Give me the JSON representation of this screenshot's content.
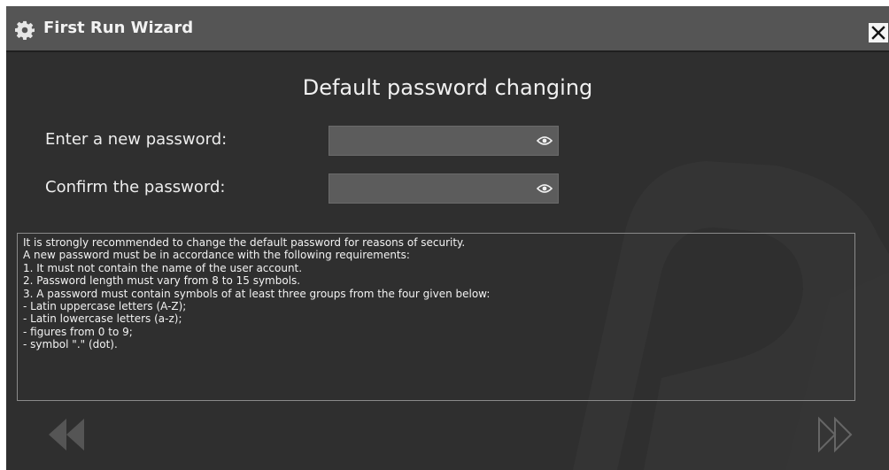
{
  "window": {
    "title": "First Run Wizard",
    "title_icon": "gear-icon",
    "close_icon": "close-icon",
    "close_label": "✕"
  },
  "main": {
    "heading": "Default password changing",
    "new_password_label": "Enter a new password:",
    "confirm_password_label": "Confirm the password:",
    "new_password_value": "",
    "confirm_password_value": "",
    "show_password_icon": "eye-icon"
  },
  "info": {
    "lines": [
      "It is strongly recommended to change the default password for reasons of security.",
      "A new password must be in accordance with the following requirements:",
      "1. It must not contain the name of the user account.",
      "2. Password length must vary from 8 to 15 symbols.",
      "3. A password must contain symbols of at least three groups from the four given below:",
      "- Latin uppercase letters (A-Z);",
      "- Latin lowercase letters (a-z);",
      "- figures from 0 to 9;",
      "- symbol \".\" (dot)."
    ]
  },
  "navigation": {
    "back_icon": "double-chevron-left-icon",
    "next_icon": "double-chevron-right-icon"
  },
  "colors": {
    "background": "#2f2f2f",
    "titlebar": "#555555",
    "input_background": "#5c5c5c",
    "text": "#f0f0f0"
  }
}
